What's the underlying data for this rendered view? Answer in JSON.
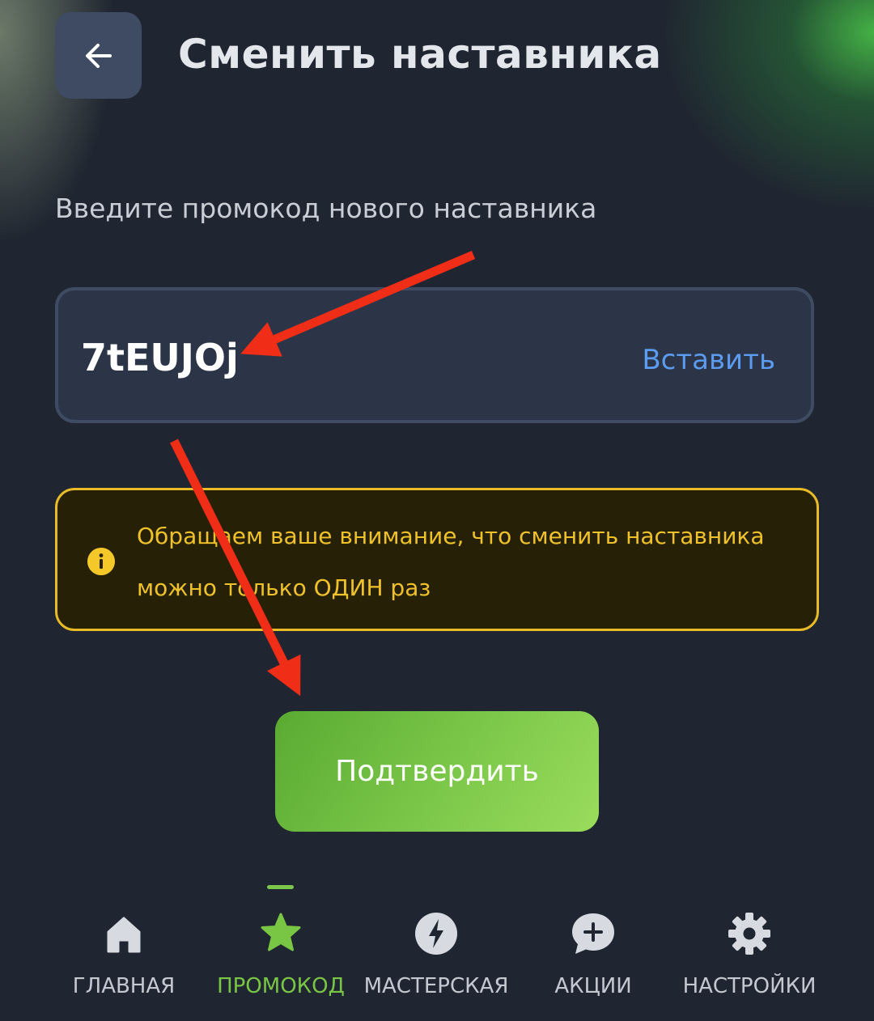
{
  "header": {
    "title": "Сменить наставника",
    "back_icon": "arrow-left-icon"
  },
  "form": {
    "prompt": "Введите промокод нового наставника",
    "code_value": "7tEUJOj",
    "paste_label": "Вставить"
  },
  "notice": {
    "line1": "Обращаем ваше внимание, что сменить наставника",
    "line2": "можно только ОДИН раз",
    "icon": "info-icon",
    "color": "#f0c22a"
  },
  "confirm": {
    "label": "Подтвердить"
  },
  "annotations": {
    "arrow_color": "#f02d17"
  },
  "nav": {
    "items": [
      {
        "label": "ГЛАВНАЯ",
        "icon": "home-icon",
        "active": false
      },
      {
        "label": "ПРОМОКОД",
        "icon": "star-icon",
        "active": true
      },
      {
        "label": "МАСТЕРСКАЯ",
        "icon": "lightning-icon",
        "active": false
      },
      {
        "label": "АКЦИИ",
        "icon": "chat-plus-icon",
        "active": false
      },
      {
        "label": "НАСТРОЙКИ",
        "icon": "gear-icon",
        "active": false
      }
    ],
    "active_color": "#79c645"
  }
}
